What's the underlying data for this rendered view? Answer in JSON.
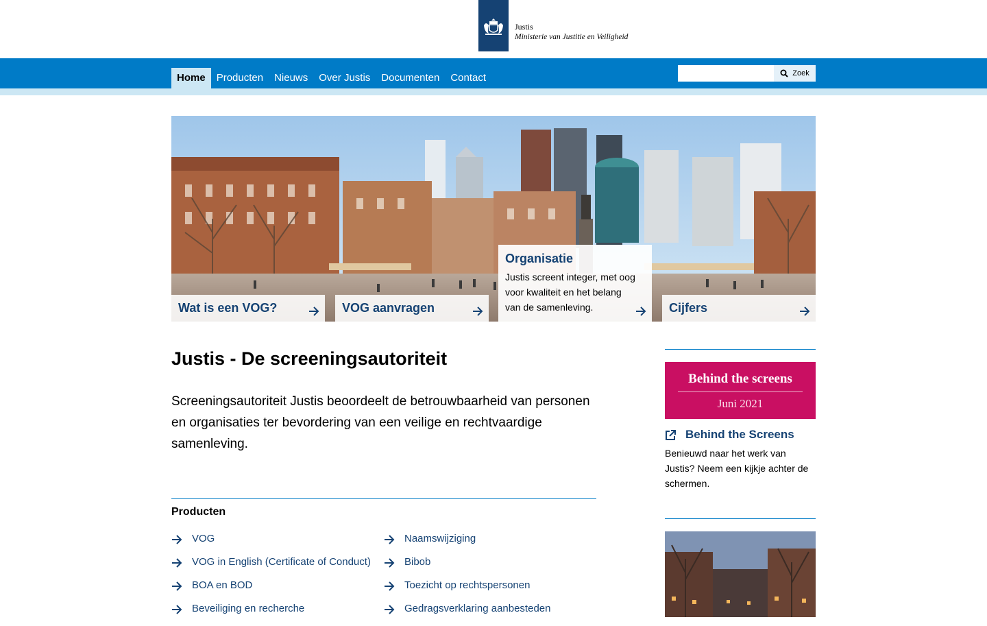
{
  "header": {
    "org_name": "Justis",
    "org_subtitle": "Ministerie van Justitie en Veiligheid"
  },
  "nav": {
    "items": [
      "Home",
      "Producten",
      "Nieuws",
      "Over Justis",
      "Documenten",
      "Contact"
    ],
    "active": "Home"
  },
  "search": {
    "placeholder": "",
    "button_label": "Zoek"
  },
  "hero": {
    "tiles": [
      {
        "label": "Wat is een VOG?"
      },
      {
        "label": "VOG aanvragen"
      },
      {
        "label": "Organisatie",
        "description": "Justis screent integer, met oog voor kwaliteit en het belang van de samenleving."
      },
      {
        "label": "Cijfers"
      }
    ]
  },
  "main": {
    "title": "Justis - De screeningsautoriteit",
    "intro": "Screeningsautoriteit Justis beoordeelt de betrouwbaarheid van personen en organisaties ter bevordering van een veilige en rechtvaardige samenleving.",
    "products_title": "Producten",
    "products_left": [
      "VOG",
      "VOG in English (Certificate of Conduct)",
      "BOA en BOD",
      "Beveiliging en recherche"
    ],
    "products_right": [
      "Naamswijziging",
      "Bibob",
      "Toezicht op rechtspersonen",
      "Gedragsverklaring aanbesteden"
    ]
  },
  "sidebar": {
    "promo_title": "Behind the screens",
    "promo_date": "Juni 2021",
    "link_label": "Behind the Screens",
    "link_desc": "Benieuwd naar het werk van Justis? Neem een kijkje achter de schermen."
  },
  "colors": {
    "nav_blue": "#007bc7",
    "link_blue": "#154273",
    "promo_pink": "#c90f62",
    "nav_sub": "#cce7f4"
  }
}
